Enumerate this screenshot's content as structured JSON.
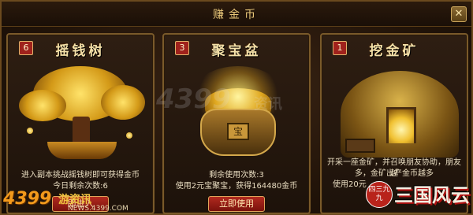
{
  "window": {
    "title": "赚金币",
    "close_label": "✕"
  },
  "cards": [
    {
      "badge": "6",
      "title": "摇钱树",
      "desc_lines": [
        "进入副本挑战摇钱树即可获得金币",
        "今日剩余次数:6"
      ],
      "button": "即进入"
    },
    {
      "badge": "3",
      "title": "聚宝盆",
      "desc_lines": [
        "剩余使用次数:3",
        "使用2元宝聚宝，获得164480金币"
      ],
      "button": "立即使用"
    },
    {
      "badge": "1",
      "title": "挖金矿",
      "desc_lines": [
        "开采一座金矿，并召唤朋友协助，朋友越",
        "多，金矿出产金币越多",
        "使用20元"
      ]
    }
  ],
  "art": {
    "pot_emblem": "宝"
  },
  "watermark": {
    "site": "4399",
    "news": "资讯"
  },
  "branding": {
    "site_logo": "4399",
    "site_sub": "游资讯",
    "site_url": "NEWS.4399.COM",
    "seal": "四三九九",
    "game_logo": "三国风云"
  },
  "colors": {
    "frame": "#7a5a2a",
    "title_text": "#f4e0a8",
    "button": "#b02a1f",
    "badge": "#a0221c"
  }
}
